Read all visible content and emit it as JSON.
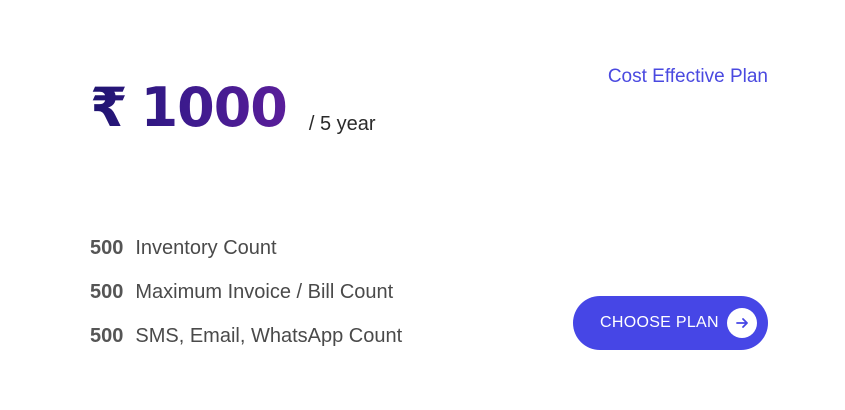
{
  "pricing": {
    "currency_symbol": "₹",
    "amount": "1000",
    "period": "/ 5 year",
    "plan_name": "Cost Effective Plan",
    "accent_color": "#4646e6",
    "price_gradient": [
      "#1f1470",
      "#5a1e9a"
    ]
  },
  "features": [
    {
      "count": "500",
      "label": "Inventory Count"
    },
    {
      "count": "500",
      "label": "Maximum Invoice / Bill Count"
    },
    {
      "count": "500",
      "label": "SMS, Email, WhatsApp Count"
    }
  ],
  "cta": {
    "label": "CHOOSE PLAN",
    "icon": "arrow-right-icon"
  }
}
